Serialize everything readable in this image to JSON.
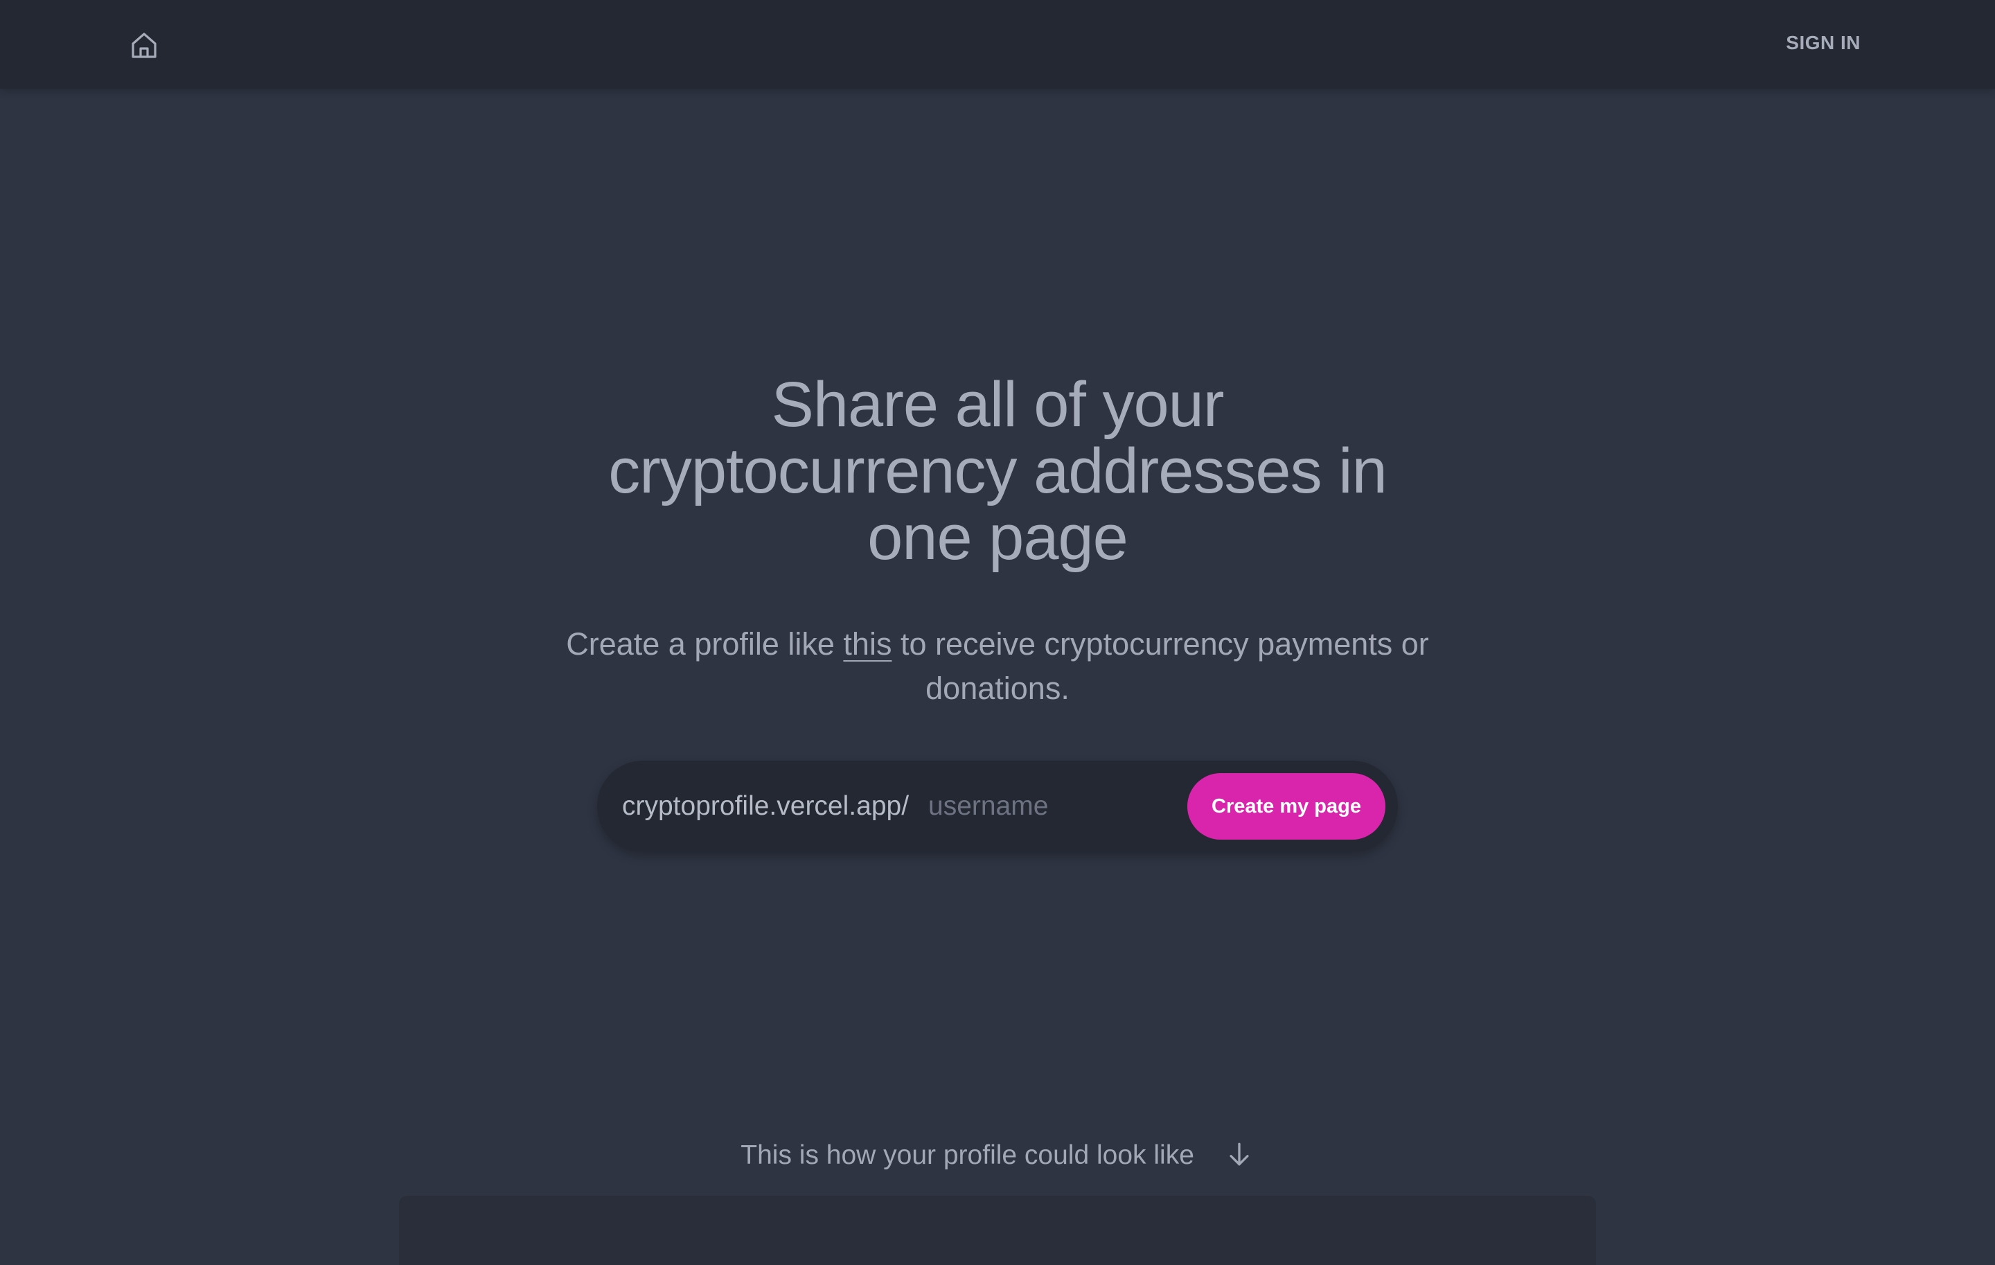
{
  "header": {
    "home_icon": "home-icon",
    "sign_in_label": "SIGN IN"
  },
  "hero": {
    "title": "Share all of your cryptocurrency addresses in one page",
    "subtitle_before": "Create a profile like ",
    "subtitle_link": "this",
    "subtitle_after": " to receive cryptocurrency payments or donations."
  },
  "signup_form": {
    "url_prefix": "cryptoprofile.vercel.app/",
    "username_value": "",
    "username_placeholder": "username",
    "submit_label": "Create my page"
  },
  "preview": {
    "caption": "This is how your profile could look like",
    "caption_icon": "arrow-down-icon"
  },
  "colors": {
    "background": "#2e3442",
    "header_background": "#242833",
    "accent": "#d925ab",
    "text": "#a7acba"
  }
}
